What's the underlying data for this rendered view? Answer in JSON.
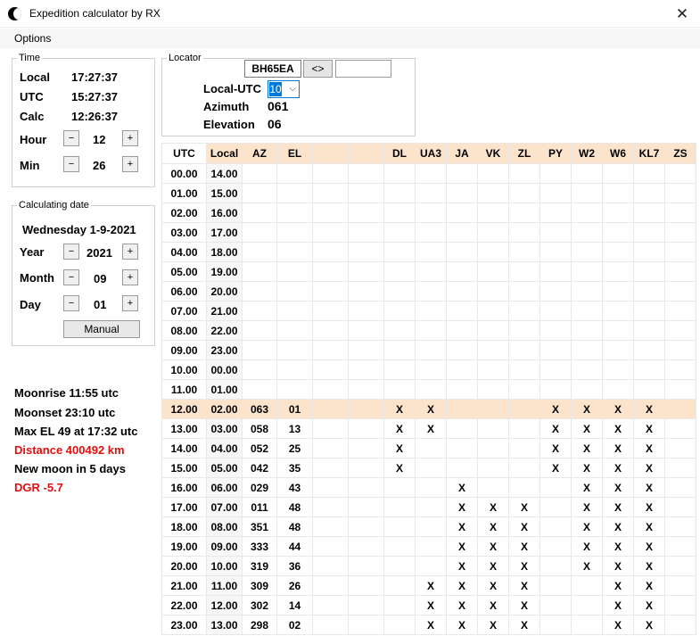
{
  "window": {
    "title": "Expedition calculator by RX"
  },
  "menu": {
    "options": "Options"
  },
  "time_panel": {
    "legend": "Time",
    "local_label": "Local",
    "local_value": "17:27:37",
    "utc_label": "UTC",
    "utc_value": "15:27:37",
    "calc_label": "Calc",
    "calc_value": "12:26:37",
    "hour_label": "Hour",
    "hour_value": "12",
    "min_label": "Min",
    "min_value": "26",
    "minus": "−",
    "plus": "+"
  },
  "date_panel": {
    "legend": "Calculating date",
    "date_text": "Wednesday 1-9-2021",
    "year_label": "Year",
    "year_value": "2021",
    "month_label": "Month",
    "month_value": "09",
    "day_label": "Day",
    "day_value": "01",
    "manual_label": "Manual"
  },
  "locator_panel": {
    "legend": "Locator",
    "locator_value": "BH65EA",
    "swap_label": "<>",
    "second_locator_value": "",
    "local_utc_label": "Local-UTC",
    "local_utc_value": "10",
    "azimuth_label": "Azimuth",
    "azimuth_value": "061",
    "elevation_label": "Elevation",
    "elevation_value": "06"
  },
  "moon_info": {
    "moonrise": "Moonrise 11:55 utc",
    "moonset": "Moonset 23:10 utc",
    "max_el": "Max EL 49 at 17:32 utc",
    "distance": "Distance 400492 km",
    "new_moon": "New moon in 5 days",
    "dgr": "DGR -5.7"
  },
  "colors": {
    "accent": "#fce4cc",
    "warning": "#e01010",
    "selection": "#0078d7"
  },
  "table": {
    "columns": [
      "UTC",
      "Local",
      "AZ",
      "EL",
      "",
      "",
      "DL",
      "UA3",
      "JA",
      "VK",
      "ZL",
      "PY",
      "W2",
      "W6",
      "KL7",
      "ZS"
    ],
    "highlight_row": 12,
    "rows": [
      [
        "00.00",
        "14.00",
        "",
        "",
        "",
        "",
        "",
        "",
        "",
        "",
        "",
        "",
        "",
        "",
        "",
        ""
      ],
      [
        "01.00",
        "15.00",
        "",
        "",
        "",
        "",
        "",
        "",
        "",
        "",
        "",
        "",
        "",
        "",
        "",
        ""
      ],
      [
        "02.00",
        "16.00",
        "",
        "",
        "",
        "",
        "",
        "",
        "",
        "",
        "",
        "",
        "",
        "",
        "",
        ""
      ],
      [
        "03.00",
        "17.00",
        "",
        "",
        "",
        "",
        "",
        "",
        "",
        "",
        "",
        "",
        "",
        "",
        "",
        ""
      ],
      [
        "04.00",
        "18.00",
        "",
        "",
        "",
        "",
        "",
        "",
        "",
        "",
        "",
        "",
        "",
        "",
        "",
        ""
      ],
      [
        "05.00",
        "19.00",
        "",
        "",
        "",
        "",
        "",
        "",
        "",
        "",
        "",
        "",
        "",
        "",
        "",
        ""
      ],
      [
        "06.00",
        "20.00",
        "",
        "",
        "",
        "",
        "",
        "",
        "",
        "",
        "",
        "",
        "",
        "",
        "",
        ""
      ],
      [
        "07.00",
        "21.00",
        "",
        "",
        "",
        "",
        "",
        "",
        "",
        "",
        "",
        "",
        "",
        "",
        "",
        ""
      ],
      [
        "08.00",
        "22.00",
        "",
        "",
        "",
        "",
        "",
        "",
        "",
        "",
        "",
        "",
        "",
        "",
        "",
        ""
      ],
      [
        "09.00",
        "23.00",
        "",
        "",
        "",
        "",
        "",
        "",
        "",
        "",
        "",
        "",
        "",
        "",
        "",
        ""
      ],
      [
        "10.00",
        "00.00",
        "",
        "",
        "",
        "",
        "",
        "",
        "",
        "",
        "",
        "",
        "",
        "",
        "",
        ""
      ],
      [
        "11.00",
        "01.00",
        "",
        "",
        "",
        "",
        "",
        "",
        "",
        "",
        "",
        "",
        "",
        "",
        "",
        ""
      ],
      [
        "12.00",
        "02.00",
        "063",
        "01",
        "",
        "",
        "X",
        "X",
        "",
        "",
        "",
        "X",
        "X",
        "X",
        "X",
        ""
      ],
      [
        "13.00",
        "03.00",
        "058",
        "13",
        "",
        "",
        "X",
        "X",
        "",
        "",
        "",
        "X",
        "X",
        "X",
        "X",
        ""
      ],
      [
        "14.00",
        "04.00",
        "052",
        "25",
        "",
        "",
        "X",
        "",
        "",
        "",
        "",
        "X",
        "X",
        "X",
        "X",
        ""
      ],
      [
        "15.00",
        "05.00",
        "042",
        "35",
        "",
        "",
        "X",
        "",
        "",
        "",
        "",
        "X",
        "X",
        "X",
        "X",
        ""
      ],
      [
        "16.00",
        "06.00",
        "029",
        "43",
        "",
        "",
        "",
        "",
        "X",
        "",
        "",
        "",
        "X",
        "X",
        "X",
        ""
      ],
      [
        "17.00",
        "07.00",
        "011",
        "48",
        "",
        "",
        "",
        "",
        "X",
        "X",
        "X",
        "",
        "X",
        "X",
        "X",
        ""
      ],
      [
        "18.00",
        "08.00",
        "351",
        "48",
        "",
        "",
        "",
        "",
        "X",
        "X",
        "X",
        "",
        "X",
        "X",
        "X",
        ""
      ],
      [
        "19.00",
        "09.00",
        "333",
        "44",
        "",
        "",
        "",
        "",
        "X",
        "X",
        "X",
        "",
        "X",
        "X",
        "X",
        ""
      ],
      [
        "20.00",
        "10.00",
        "319",
        "36",
        "",
        "",
        "",
        "",
        "X",
        "X",
        "X",
        "",
        "X",
        "X",
        "X",
        ""
      ],
      [
        "21.00",
        "11.00",
        "309",
        "26",
        "",
        "",
        "",
        "X",
        "X",
        "X",
        "X",
        "",
        "",
        "X",
        "X",
        ""
      ],
      [
        "22.00",
        "12.00",
        "302",
        "14",
        "",
        "",
        "",
        "X",
        "X",
        "X",
        "X",
        "",
        "",
        "X",
        "X",
        ""
      ],
      [
        "23.00",
        "13.00",
        "298",
        "02",
        "",
        "",
        "",
        "X",
        "X",
        "X",
        "X",
        "",
        "",
        "X",
        "X",
        ""
      ]
    ]
  }
}
